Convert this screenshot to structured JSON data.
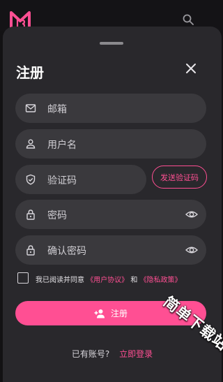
{
  "sheet": {
    "title": "注册",
    "fields": {
      "email_placeholder": "邮箱",
      "username_placeholder": "用户名",
      "code_placeholder": "验证码",
      "password_placeholder": "密码",
      "confirm_placeholder": "确认密码"
    },
    "send_code_label": "发送验证码",
    "agreement": {
      "prefix": "我已阅读并同意",
      "terms_link": "《用户协议》",
      "connector": "和",
      "privacy_link": "《隐私政策》",
      "checked": false
    },
    "submit_label": "注册",
    "footer": {
      "question": "已有账号?",
      "login_link": "立即登录"
    }
  },
  "watermark": "简单下载站",
  "colors": {
    "accent": "#ff4f93",
    "sheet_bg": "#29282c",
    "field_bg": "#3a393d",
    "page_bg": "#131214"
  },
  "icons": [
    "app-logo-icon",
    "search-icon",
    "close-icon",
    "mail-icon",
    "user-icon",
    "shield-icon",
    "lock-icon",
    "eye-icon",
    "add-user-icon"
  ]
}
